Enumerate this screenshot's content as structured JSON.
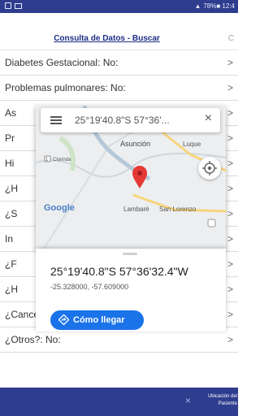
{
  "status_bar": {
    "right_text": "78%■ 12:4"
  },
  "header": {
    "title": "Consulta de Datos -  Buscar",
    "partial_right": "C"
  },
  "rows": [
    {
      "label": "Diabetes Gestacional: No:"
    },
    {
      "label": "Problemas pulmonares: No:"
    },
    {
      "label": "As"
    },
    {
      "label": "Pr"
    },
    {
      "label": "Hi"
    },
    {
      "label": "¿H"
    },
    {
      "label": "¿S"
    },
    {
      "label": "In"
    },
    {
      "label": "¿F"
    },
    {
      "label": "¿H"
    },
    {
      "label": "¿Cancer?: No: —"
    },
    {
      "label": "¿Otros?: No:"
    }
  ],
  "chevron": ">",
  "map": {
    "search_text": "25°19'40.8\"S 57°36'...",
    "close_label": "×",
    "places": {
      "asuncion": "Asunción",
      "luque": "Luque",
      "lambare": "Lambaré",
      "san_lorenzo": "San Lorenzo",
      "clorinda": "Clorinda",
      "route_badge": "1"
    },
    "provider_logo": "Google",
    "marker_color": "#e53935"
  },
  "info": {
    "coords_dms": "25°19'40.8\"S 57°36'32.4\"W",
    "coords_decimal": "-25.328000, -57.609000",
    "directions_label": "Cómo llegar"
  },
  "footer": {
    "close_label": "×",
    "note": "Ubicación del Paciente"
  },
  "colors": {
    "bar": "#2f3d8e",
    "header_title": "#1c2e86",
    "directions_button": "#1a73e8"
  }
}
